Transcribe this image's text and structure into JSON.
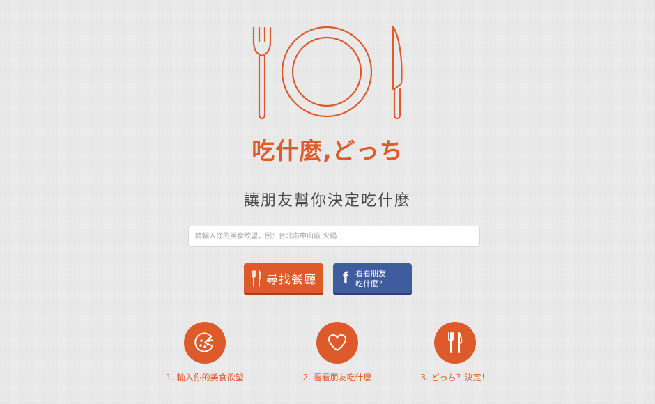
{
  "brand": {
    "title": "吃什麼,どっち",
    "logo_icon": "plate-fork-knife-icon"
  },
  "tagline": "讓朋友幫你決定吃什麼",
  "search": {
    "placeholder": "請輸入你的美食欲望，例：台北市中山區 火鍋",
    "value": ""
  },
  "buttons": {
    "find": {
      "label": "尋找餐廳",
      "icon": "fork-knife-icon"
    },
    "facebook": {
      "line1": "看看朋友",
      "line2": "吃什麼？",
      "icon": "facebook-icon"
    }
  },
  "steps": [
    {
      "label": "1. 輸入你的美食欲望",
      "icon": "pizza-icon"
    },
    {
      "label": "2. 看看朋友吃什麼",
      "icon": "heart-icon"
    },
    {
      "label": "3. どっち？決定！",
      "icon": "fork-knife-icon"
    }
  ],
  "colors": {
    "accent": "#df5a2a",
    "facebook": "#3e5c9e",
    "background": "#ececec",
    "text": "#4a4a4a"
  }
}
